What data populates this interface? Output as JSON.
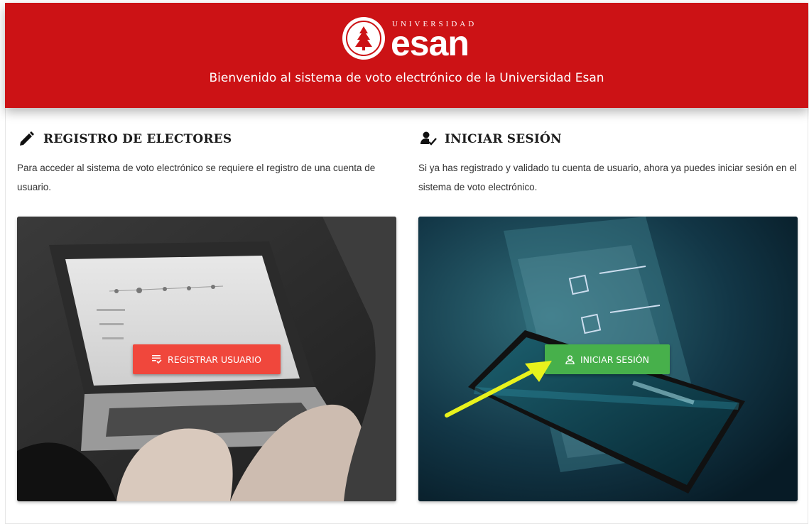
{
  "header": {
    "logo_small": "UNIVERSIDAD",
    "logo_big": "esan",
    "welcome": "Bienvenido al sistema de voto electrónico de la Universidad Esan",
    "bg_color": "#cc1215"
  },
  "register": {
    "title": "REGISTRO DE ELECTORES",
    "description": "Para acceder al sistema de voto electrónico se requiere el registro de una cuenta de usuario.",
    "icon": "pencil-icon",
    "button_label": "REGISTRAR USUARIO",
    "button_icon": "list-check-icon",
    "button_color": "#f0473c"
  },
  "login": {
    "title": "INICIAR SESIÓN",
    "description": "Si ya has registrado y validado tu cuenta de usuario, ahora ya puedes iniciar sesión en el sistema de voto electrónico.",
    "icon": "user-check-icon",
    "button_label": "INICIAR SESIÓN",
    "button_icon": "user-icon",
    "button_color": "#47b04b"
  },
  "annotation": {
    "arrow_color": "#e8f21c"
  }
}
